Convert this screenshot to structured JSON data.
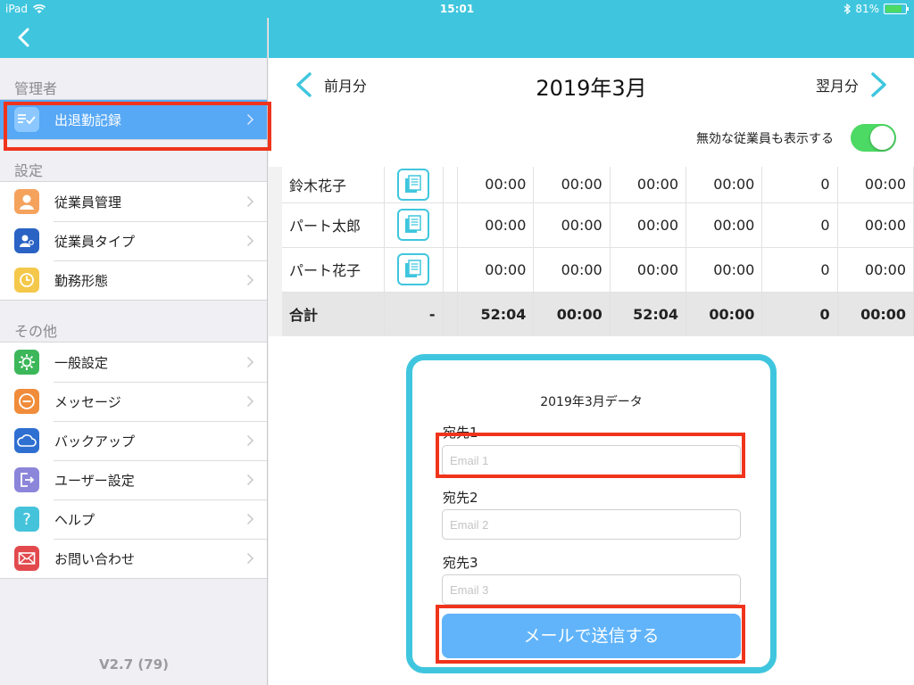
{
  "status_bar": {
    "device": "iPad",
    "time": "15:01",
    "battery": "81%"
  },
  "colors": {
    "accent": "#3fc6de",
    "active": "#57a8f5",
    "button": "#61b4fa",
    "highlight": "#f0341c",
    "toggle_on": "#4cd964"
  },
  "sidebar": {
    "sections": [
      {
        "title": "管理者",
        "items": [
          {
            "label": "出退勤記録",
            "icon": "list-check-icon",
            "active": true
          }
        ]
      },
      {
        "title": "設定",
        "items": [
          {
            "label": "従業員管理",
            "icon": "person-icon"
          },
          {
            "label": "従業員タイプ",
            "icon": "person-type-icon"
          },
          {
            "label": "勤務形態",
            "icon": "clock-icon"
          }
        ]
      },
      {
        "title": "その他",
        "items": [
          {
            "label": "一般設定",
            "icon": "gear-icon"
          },
          {
            "label": "メッセージ",
            "icon": "message-icon"
          },
          {
            "label": "バックアップ",
            "icon": "cloud-icon"
          },
          {
            "label": "ユーザー設定",
            "icon": "logout-icon"
          },
          {
            "label": "ヘルプ",
            "icon": "help-icon"
          },
          {
            "label": "お問い合わせ",
            "icon": "mail-icon"
          }
        ]
      }
    ],
    "version": "V2.7 (79)"
  },
  "month_nav": {
    "prev_label": "前月分",
    "title": "2019年3月",
    "next_label": "翌月分"
  },
  "toggle": {
    "label": "無効な従業員も表示する",
    "on": true
  },
  "table": {
    "rows": [
      {
        "name": "鈴木花子",
        "values": [
          "00:00",
          "00:00",
          "00:00",
          "00:00",
          "0",
          "00:00"
        ]
      },
      {
        "name": "パート太郎",
        "values": [
          "00:00",
          "00:00",
          "00:00",
          "00:00",
          "0",
          "00:00"
        ]
      },
      {
        "name": "パート花子",
        "values": [
          "00:00",
          "00:00",
          "00:00",
          "00:00",
          "0",
          "00:00"
        ]
      }
    ],
    "total": {
      "name": "合計",
      "doc": "-",
      "values": [
        "52:04",
        "00:00",
        "52:04",
        "00:00",
        "0",
        "00:00"
      ]
    }
  },
  "email_card": {
    "title": "2019年3月データ",
    "fields": [
      {
        "label": "宛先1",
        "placeholder": "Email 1",
        "value": ""
      },
      {
        "label": "宛先2",
        "placeholder": "Email 2",
        "value": ""
      },
      {
        "label": "宛先3",
        "placeholder": "Email 3",
        "value": ""
      }
    ],
    "send_label": "メールで送信する"
  }
}
